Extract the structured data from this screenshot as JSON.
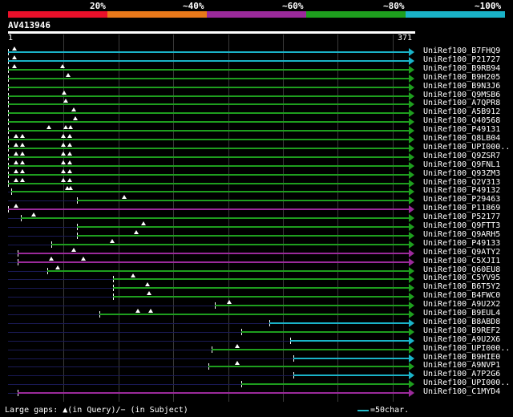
{
  "legend": {
    "labels": [
      "20%",
      "~40%",
      "~60%",
      "~80%",
      "~100%"
    ],
    "colors": [
      "#e8102a",
      "#e8781a",
      "#9b2a9b",
      "#1e9e1e",
      "#1ab3c8"
    ]
  },
  "query": {
    "name": "AV413946",
    "start": "1",
    "end": "371"
  },
  "hits": [
    {
      "label": "UniRef100_B7FHQ9",
      "color": "#1ab3c8"
    },
    {
      "label": "UniRef100_P21727",
      "color": "#1ab3c8"
    },
    {
      "label": "UniRef100_B9RB94",
      "color": "#1e9e1e"
    },
    {
      "label": "UniRef100_B9H205",
      "color": "#1e9e1e"
    },
    {
      "label": "UniRef100_B9N3J6",
      "color": "#1e9e1e"
    },
    {
      "label": "UniRef100_Q9MSB6",
      "color": "#1e9e1e"
    },
    {
      "label": "UniRef100_A7QPR8",
      "color": "#1e9e1e"
    },
    {
      "label": "UniRef100_A5B912",
      "color": "#1e9e1e"
    },
    {
      "label": "UniRef100_Q40568",
      "color": "#1e9e1e"
    },
    {
      "label": "UniRef100_P49131",
      "color": "#1e9e1e"
    },
    {
      "label": "UniRef100_Q8LB04",
      "color": "#1e9e1e"
    },
    {
      "label": "UniRef100_UPI000..",
      "color": "#1e9e1e"
    },
    {
      "label": "UniRef100_Q9ZSR7",
      "color": "#1e9e1e"
    },
    {
      "label": "UniRef100_Q9FNL1",
      "color": "#1e9e1e"
    },
    {
      "label": "UniRef100_Q93ZM3",
      "color": "#1e9e1e"
    },
    {
      "label": "UniRef100_Q2V313",
      "color": "#1e9e1e"
    },
    {
      "label": "UniRef100_P49132",
      "color": "#1e9e1e"
    },
    {
      "label": "UniRef100_P29463",
      "color": "#1e9e1e"
    },
    {
      "label": "UniRef100_P11869",
      "color": "#9b2a9b"
    },
    {
      "label": "UniRef100_P52177",
      "color": "#1e9e1e"
    },
    {
      "label": "UniRef100_Q9FTT3",
      "color": "#1e9e1e"
    },
    {
      "label": "UniRef100_Q9ARH5",
      "color": "#1e9e1e"
    },
    {
      "label": "UniRef100_P49133",
      "color": "#1e9e1e"
    },
    {
      "label": "UniRef100_Q9ATY2",
      "color": "#9b2a9b"
    },
    {
      "label": "UniRef100_C5XJI1",
      "color": "#9b2a9b"
    },
    {
      "label": "UniRef100_Q60EU8",
      "color": "#1e9e1e"
    },
    {
      "label": "UniRef100_C5YV95",
      "color": "#1e9e1e"
    },
    {
      "label": "UniRef100_B6T5Y2",
      "color": "#1e9e1e"
    },
    {
      "label": "UniRef100_B4FWC0",
      "color": "#1e9e1e"
    },
    {
      "label": "UniRef100_A9U2X2",
      "color": "#1e9e1e"
    },
    {
      "label": "UniRef100_B9EUL4",
      "color": "#1e9e1e"
    },
    {
      "label": "UniRef100_B8ABD8",
      "color": "#1ab3c8"
    },
    {
      "label": "UniRef100_B9REF2",
      "color": "#1e9e1e"
    },
    {
      "label": "UniRef100_A9U2X6",
      "color": "#1ab3c8"
    },
    {
      "label": "UniRef100_UPI000..",
      "color": "#1e9e1e"
    },
    {
      "label": "UniRef100_B9HIE0",
      "color": "#1ab3c8"
    },
    {
      "label": "UniRef100_A9NVP1",
      "color": "#1e9e1e"
    },
    {
      "label": "UniRef100_A7P2G6",
      "color": "#1ab3c8"
    },
    {
      "label": "UniRef100_UPI000..",
      "color": "#1e9e1e"
    },
    {
      "label": "UniRef100_C1MYD4",
      "color": "#9b2a9b"
    }
  ],
  "footer": {
    "text": "Large gaps: ▲(in Query)/− (in Subject)",
    "scale": "=50char."
  }
}
